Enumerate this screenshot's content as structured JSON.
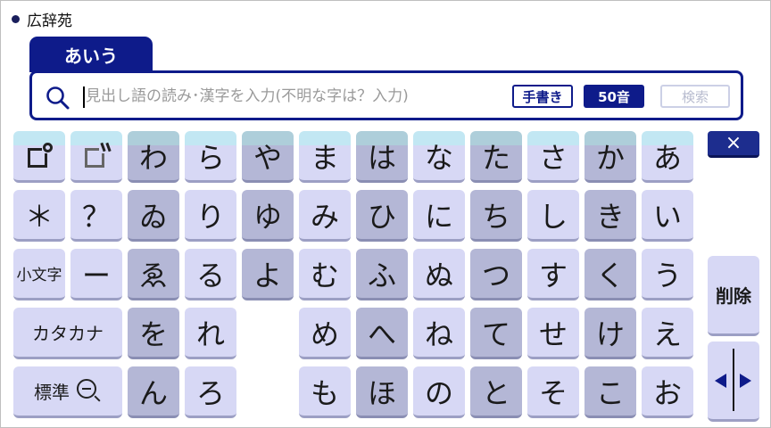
{
  "dictionary": {
    "title": "広辞苑"
  },
  "mode_tab": {
    "label": "あいう"
  },
  "search": {
    "placeholder": "見出し語の読み･漢字を入力(不明な字は？入力)",
    "value": "",
    "handwrite_label": "手書き",
    "fifty_on_label": "50音",
    "search_label": "検索"
  },
  "side": {
    "close_label": "×",
    "delete_label": "削除"
  },
  "keys": {
    "r1": [
      "わ",
      "ら",
      "や",
      "ま",
      "は",
      "な",
      "た",
      "さ",
      "か",
      "あ"
    ],
    "r2": [
      "＊",
      "？",
      "ゐ",
      "り",
      "ゆ",
      "み",
      "ひ",
      "に",
      "ち",
      "し",
      "き",
      "い"
    ],
    "r3": [
      "小文字",
      "ー",
      "ゑ",
      "る",
      "よ",
      "む",
      "ふ",
      "ぬ",
      "つ",
      "す",
      "く",
      "う"
    ],
    "r4": [
      "カタカナ",
      "を",
      "れ",
      "め",
      "へ",
      "ね",
      "て",
      "せ",
      "け",
      "え"
    ],
    "r5": [
      "標準",
      "ん",
      "ろ",
      "も",
      "ほ",
      "の",
      "と",
      "そ",
      "こ",
      "お"
    ]
  },
  "icons": {
    "search": "magnifier-icon",
    "handakuten": "handakuten-small-icon",
    "dakuten": "dakuten-small-icon",
    "zoom_out": "zoom-out-icon",
    "cursor_left": "arrow-left-icon",
    "cursor_right": "arrow-right-icon"
  },
  "colors": {
    "accent": "#0e1b8a",
    "key_light": "#d7d8f5",
    "key_dark": "#b4b7d6",
    "key_top": "#c2e7f3"
  }
}
